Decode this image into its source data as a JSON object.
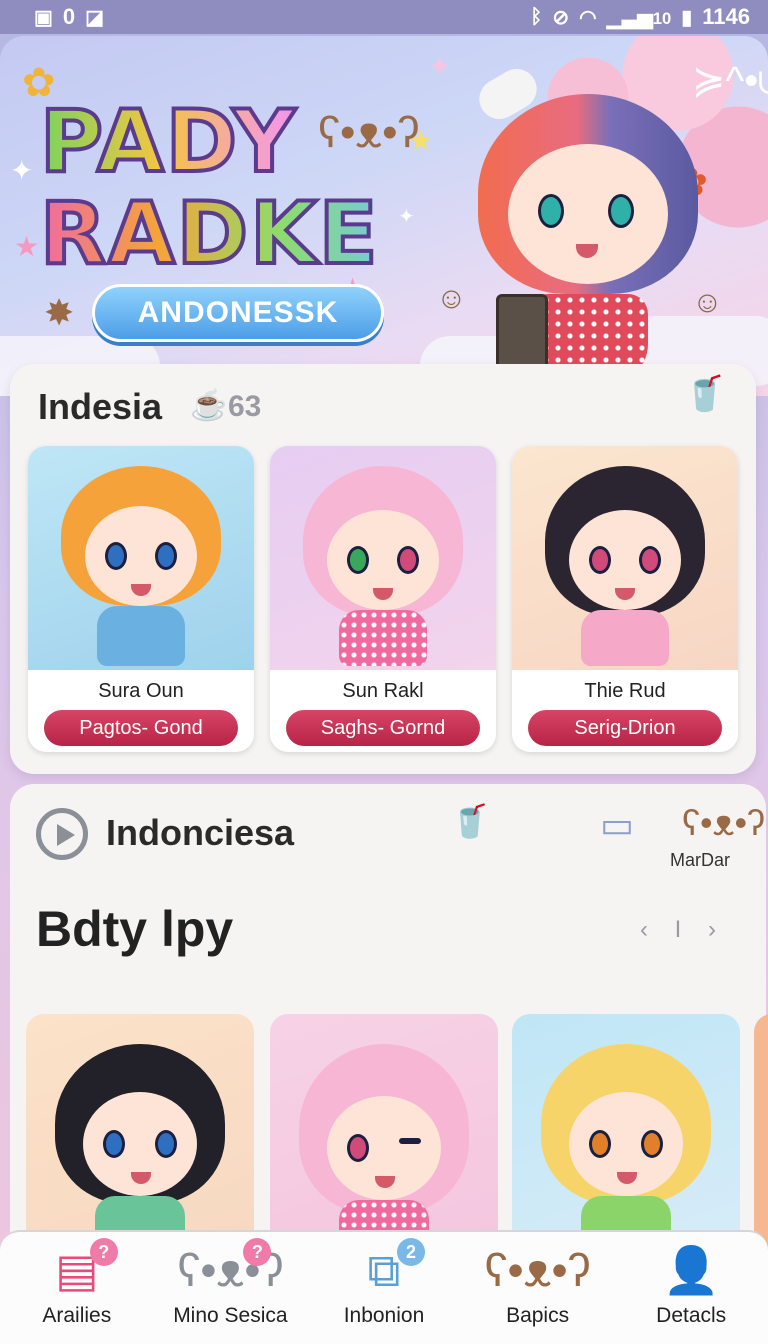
{
  "status_bar": {
    "left_text": "0",
    "time": "1146",
    "signal": "10"
  },
  "hero": {
    "logo_line1": "PADY",
    "logo_line2": "RADKE",
    "pill_label": "ANDONESSK"
  },
  "section1": {
    "title": "Indesia",
    "count": "63",
    "items": [
      {
        "name": "Sura Oun",
        "button": "Pagtos- Gond"
      },
      {
        "name": "Sun Rakl",
        "button": "Saghs- Gornd"
      },
      {
        "name": "Thie Rud",
        "button": "Serig-Drion"
      }
    ]
  },
  "section2": {
    "title": "Indonciesa",
    "corner_label": "MarDar",
    "subtitle": "Bdty lpy",
    "pager": "‹ I ›"
  },
  "bottom_nav": [
    {
      "label": "Arailies",
      "icon": "list-icon",
      "badge": "?",
      "badge_color": "#f07aa8"
    },
    {
      "label": "Mino Sesica",
      "icon": "mascot-icon",
      "badge": "?",
      "badge_color": "#f07aa8"
    },
    {
      "label": "Inbonion",
      "icon": "box-icon",
      "badge": "2",
      "badge_color": "#7ab8e8"
    },
    {
      "label": "Bapics",
      "icon": "bear-icon",
      "badge": "",
      "badge_color": ""
    },
    {
      "label": "Detacls",
      "icon": "user-icon",
      "badge": "",
      "badge_color": ""
    }
  ],
  "colors": {
    "accent_red": "#c8304f",
    "pill_blue": "#4d9ee8",
    "background": "#f6f4f2"
  }
}
